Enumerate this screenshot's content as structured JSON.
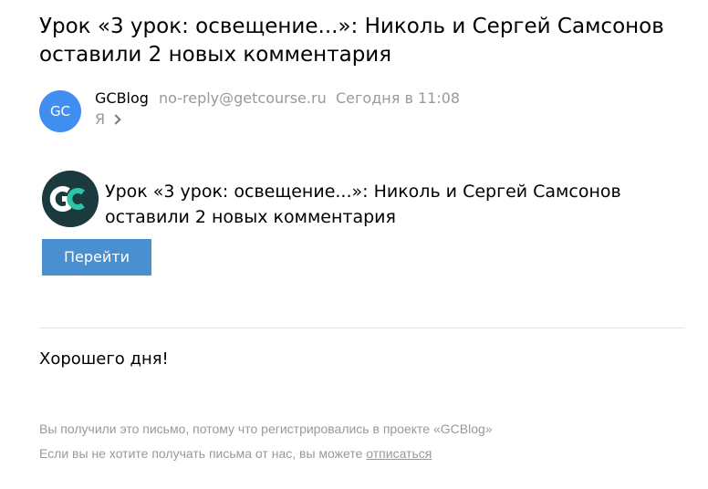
{
  "email": {
    "subject": "Урок «3 урок: освещение...»: Николь и Сергей Самсонов оставили 2 новых комментария",
    "sender": {
      "avatar_initials": "GC",
      "avatar_color": "#3f8ef0",
      "name": "GCBlog",
      "address": "no-reply@getcourse.ru",
      "time": "Сегодня в 11:08"
    },
    "recipient": "Я"
  },
  "body": {
    "logo_icon": "getcourse-logo-icon",
    "logo_text": "GC",
    "notice": "Урок «3 урок: освещение...»: Николь и Сергей Самсонов оставили 2 новых комментария",
    "button_label": "Перейти",
    "button_color": "#4a8fcf",
    "greeting": "Хорошего дня!"
  },
  "footer": {
    "line1": "Вы получили это письмо, потому что регистрировались в проекте «GCBlog»",
    "line2_prefix": "Если вы не хотите получать письма от нас, вы можете ",
    "unsubscribe_label": "отписаться"
  }
}
